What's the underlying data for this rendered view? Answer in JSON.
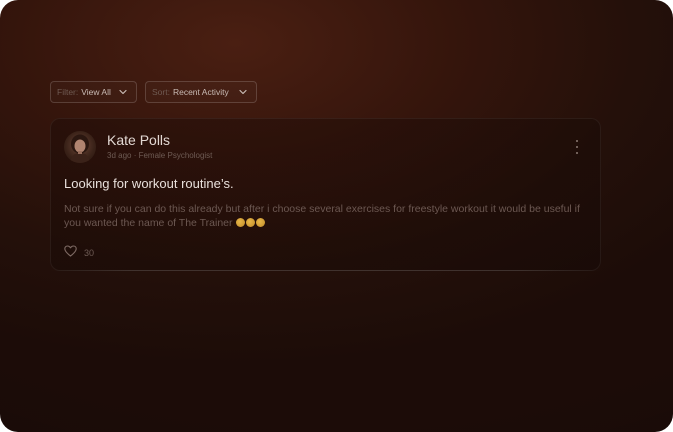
{
  "filters": {
    "filter": {
      "prefix": "Filter:",
      "value": "View All"
    },
    "sort": {
      "prefix": "Sort:",
      "value": "Recent Activity"
    }
  },
  "post": {
    "author": "Kate Polls",
    "meta": "3d ago · Female Psychologist",
    "title": "Looking for workout routine’s.",
    "body": "Not sure if you can do this already but after i choose several exercises for freestyle workout it would be useful if you wanted the name of The Trainer",
    "emoji_count": 3,
    "likes": "30",
    "icons": {
      "avatar": "avatar-photo",
      "more": "more-vertical-icon",
      "like": "heart-icon",
      "dropdown": "chevron-down-icon"
    }
  },
  "colors": {
    "background": "#2a120a",
    "text_primary": "#e2d8d3",
    "text_muted": "#6e5b54"
  }
}
